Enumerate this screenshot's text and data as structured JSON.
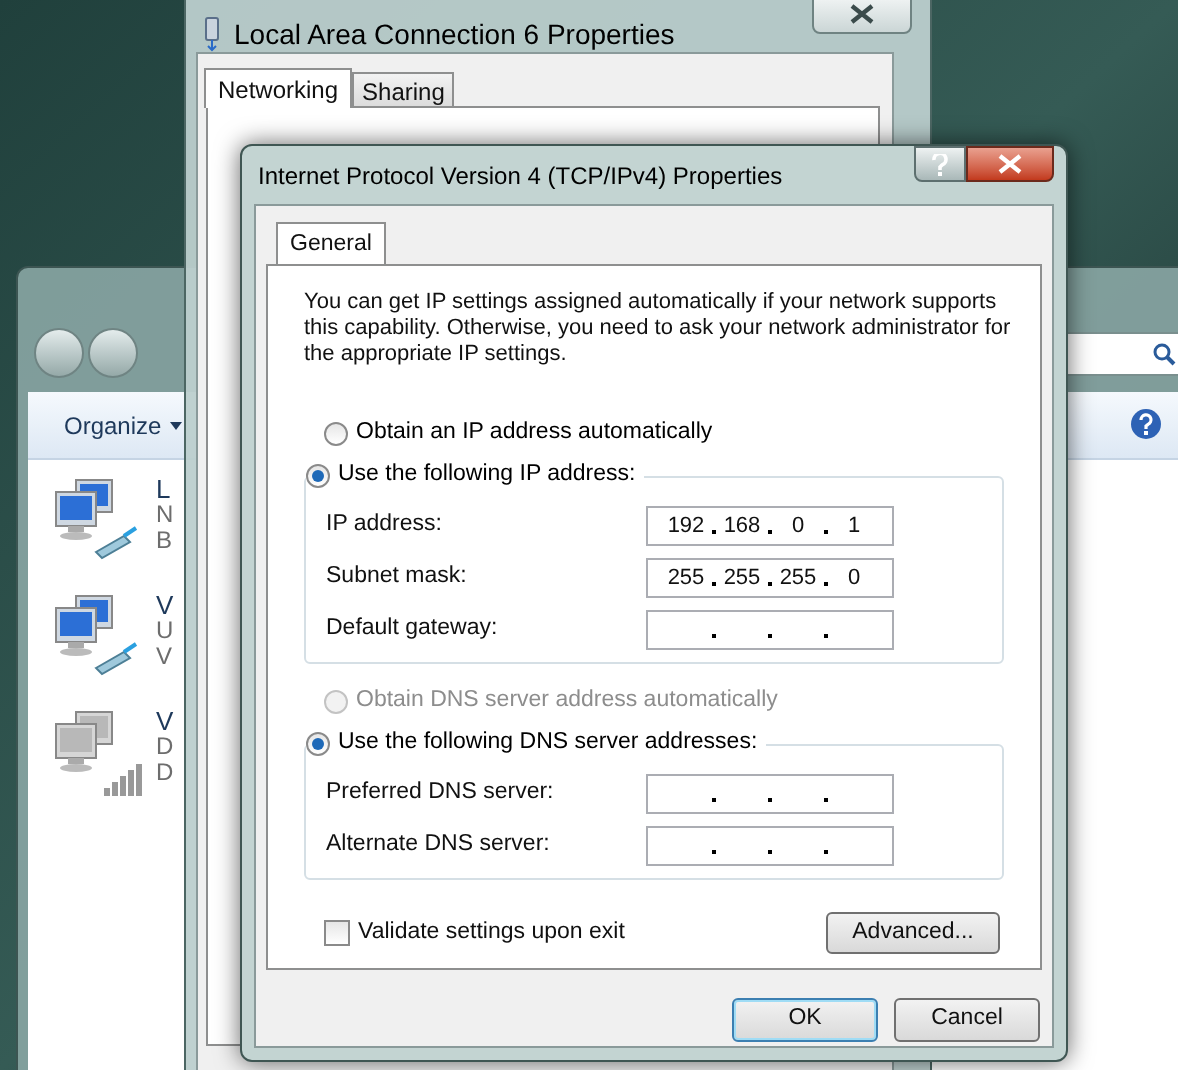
{
  "explorer": {
    "toolbar": {
      "organize": "Organize"
    },
    "connections": [
      {
        "name": "L",
        "lines": [
          "N",
          "B"
        ],
        "kind": "wired"
      },
      {
        "name": "V",
        "lines": [
          "U",
          "V"
        ],
        "kind": "wired"
      },
      {
        "name": "V",
        "lines": [
          "D",
          "D"
        ],
        "kind": "wireless"
      }
    ]
  },
  "lac_window": {
    "title": "Local Area Connection 6 Properties",
    "tabs": [
      {
        "label": "Networking",
        "selected": true
      },
      {
        "label": "Sharing",
        "selected": false
      }
    ]
  },
  "dialog": {
    "title": "Internet Protocol Version 4 (TCP/IPv4) Properties",
    "tabs": [
      {
        "label": "General",
        "selected": true
      }
    ],
    "description": "You can get IP settings assigned automatically if your network supports this capability. Otherwise, you need to ask your network administrator for the appropriate IP settings.",
    "ip_options": [
      {
        "label": "Obtain an IP address automatically",
        "selected": false,
        "disabled": false
      },
      {
        "label": "Use the following IP address:",
        "selected": true,
        "disabled": false
      }
    ],
    "ip_fields": [
      {
        "label": "IP address:",
        "octets": [
          "192",
          "168",
          "0",
          "1"
        ]
      },
      {
        "label": "Subnet mask:",
        "octets": [
          "255",
          "255",
          "255",
          "0"
        ]
      },
      {
        "label": "Default gateway:"
      }
    ],
    "dns_options": [
      {
        "label": "Obtain DNS server address automatically",
        "selected": false,
        "disabled": true
      },
      {
        "label": "Use the following DNS server addresses:",
        "selected": true,
        "disabled": false
      }
    ],
    "dns_fields": [
      {
        "label": "Preferred DNS server:"
      },
      {
        "label": "Alternate DNS server:"
      }
    ],
    "validate": {
      "label": "Validate settings upon exit",
      "checked": false
    },
    "advanced_button": "Advanced...",
    "buttons": [
      {
        "label": "OK",
        "kind": "default"
      },
      {
        "label": "Cancel",
        "kind": "normal"
      }
    ]
  }
}
